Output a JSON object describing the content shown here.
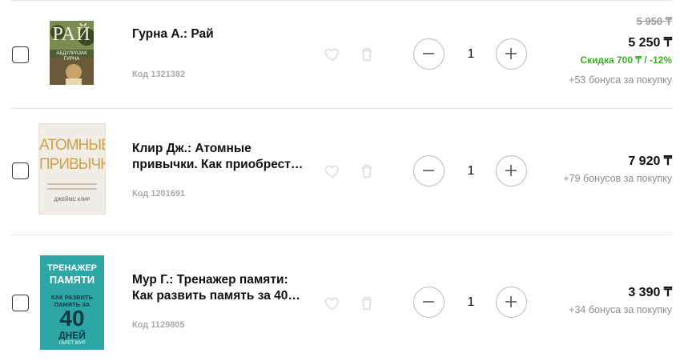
{
  "cart": {
    "items": [
      {
        "title": "Гурна А.: Рай",
        "code": "Код 1321382",
        "quantity": "1",
        "old_price": "5 950 ₸",
        "price": "5 250 ₸",
        "discount": "Скидка 700 ₸ / -12%",
        "bonus": "+53 бонуса за покупку",
        "cover": {
          "top_text": "РАЙ",
          "author": "АБДУЛРАЗАК ГУРНА",
          "bg": "#5b6b3c"
        }
      },
      {
        "title": "Клир Дж.: Атомные привычки. Как приобрест…",
        "code": "Код 1201691",
        "quantity": "1",
        "price": "7 920 ₸",
        "bonus": "+79 бонусов за покупку",
        "cover": {
          "line1": "АТОМНЫЕ",
          "line2": "ПРИВЫЧКИ",
          "author": "ДЖЕЙМС КЛИР",
          "bg": "#f1ede4"
        }
      },
      {
        "title": "Мур Г.: Тренажер памяти: Как развить память за 40…",
        "code": "Код 1129805",
        "quantity": "1",
        "price": "3 390 ₸",
        "bonus": "+34 бонуса за покупку",
        "cover": {
          "line1": "ТРЕНАЖЕР",
          "line2": "ПАМЯТИ",
          "line3": "КАК РАЗВИТЬ",
          "line4": "ПАМЯТЬ ЗА",
          "line5": "40",
          "line6": "ДНЕЙ",
          "author": "ГАРЕТ МУР",
          "bg": "#2fa6a6"
        }
      }
    ]
  }
}
